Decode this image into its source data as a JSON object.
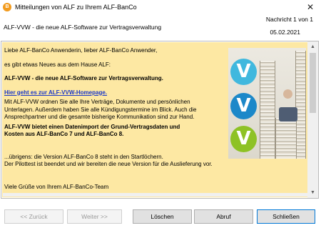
{
  "window": {
    "title": "Mitteilungen von ALF zu Ihrem ALF-BanCo",
    "close_glyph": "✕",
    "app_icon_letter": "B"
  },
  "header": {
    "subject": "ALF-VVW - die neue ALF-Software zur Vertragsverwaltung",
    "counter": "Nachricht 1 von 1",
    "date": "05.02.2021"
  },
  "message": {
    "greeting": "Liebe ALF-BanCo Anwenderin, lieber ALF-BanCo Anwender,",
    "intro": "es gibt etwas Neues aus dem Hause ALF:",
    "headline": "ALF-VVW - die neue ALF-Software zur Vertragsverwaltung.",
    "link": "Hier geht es zur ALF-VVW-Homepage.",
    "body_1": "Mit ALF-VVW ordnen Sie alle Ihre Verträge, Dokumente und persönlichen",
    "body_2": "Unterlagen. Außerdem haben Sie alle Kündigungstermine im Blick. Auch die",
    "body_3": "Ansprechpartner und die gesamte bisherige Kommunikation sind zur Hand.",
    "import_1": "ALF-VVW bietet einen Datenimport der Grund-Vertragsdaten und",
    "import_2": "Kosten aus ALF-BanCo 7 und ALF-BanCo 8.",
    "ps_1": "...übrigens: die Version ALF-BanCo 8 steht in den Startlöchern.",
    "ps_2": "Der Pilottest ist beendet und wir bereiten die neue Version für die Auslieferung vor.",
    "closing": "Viele Grüße von Ihrem ALF-BanCo-Team"
  },
  "illustration": {
    "v_letter": "V",
    "colors": [
      "#40b8de",
      "#1c88c9",
      "#8ec225"
    ]
  },
  "buttons": {
    "back": "<< Zurück",
    "next": "Weiter >>",
    "delete": "Löschen",
    "fetch": "Abruf",
    "close": "Schließen"
  },
  "icons": {
    "scroll_up": "▲",
    "scroll_down": "▼"
  }
}
